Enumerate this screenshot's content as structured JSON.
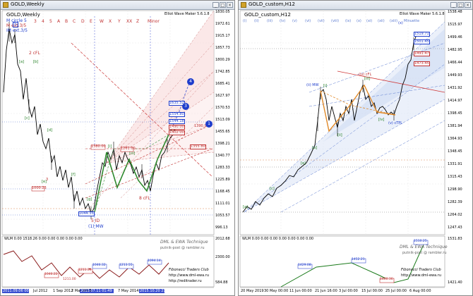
{
  "left": {
    "title": "GOLD,Weekly",
    "indicator": "Elliot Wave Maker 5.6.1.8",
    "stack": [
      "M circle 5",
      "M ext.3/5",
      "IM ext.3/5"
    ],
    "waves_top": [
      "3",
      "4",
      "5",
      "A",
      "B",
      "C",
      "D",
      "E",
      "W",
      "X",
      "Y",
      "XX",
      "Z",
      "Minor"
    ],
    "price_scale": [
      "1830.05",
      "1972.61",
      "1915.17",
      "1857.73",
      "1800.29",
      "1742.85",
      "1685.41",
      "1627.97",
      "1570.53",
      "1513.09",
      "1455.65",
      "1398.21",
      "1340.77",
      "1283.33",
      "1225.89",
      "1168.45",
      "1111.01",
      "1053.57",
      "996.13"
    ],
    "wave_labels": {
      "top5": "5",
      "cFL": "2 cFL",
      "w3": "3",
      "w5": "5 ID",
      "mw": "(1) MW",
      "cfl8": "8 cFL",
      "pr_a": "1000.23",
      "pr_b": "1044.35",
      "pr_c": "1380.00",
      "pr_d": "1261.00"
    },
    "price_boxes": [
      "1635.52",
      "1554.80",
      "1544.18",
      "1490.00",
      "1402.00",
      "1390.93",
      "1355.80"
    ],
    "circles": [
      "4",
      "3",
      "1"
    ],
    "sub_title": "WLM 0.00 1518.26 0.00 0.00 0.00 0.00 0.00",
    "sub_scale": [
      "2012.68",
      "2300.00",
      "584.88"
    ],
    "sub_values": [
      "1046.32",
      "1213.55",
      "1046.22",
      "1211.34",
      "1094.14",
      "1211.00"
    ],
    "watermark": [
      "DML & EWA Technique",
      "putnik-post @ rambler.ru"
    ],
    "signature": [
      "Fibonacci Traders Club",
      "http://www.dml-ewa.ru",
      "http://reditrader.ru"
    ],
    "dates": [
      "2011.09.06 00:00",
      "Jul 2012",
      "1 Sep 2012",
      "2 Mar 2013",
      "2013.07.11 01:49",
      "7 May 2014",
      "2015.10.20 21:00"
    ]
  },
  "right": {
    "title": "GOLD_custom,H12",
    "indicator": "Elliot Wave Maker 5.6.1.8",
    "waves_top": [
      "(i)",
      "(ii)",
      "(iii)",
      "(iv)",
      "(v)",
      "(vi)",
      "(vii)",
      "(viii)",
      "(ix)",
      "(x)",
      "(xi)",
      "(xii)",
      "(xiii)",
      "Minuette"
    ],
    "price_scale": [
      "1538.48",
      "1515.97",
      "1499.46",
      "1482.95",
      "1466.44",
      "1449.93",
      "1431.92",
      "1414.97",
      "1398.45",
      "1381.94",
      "1364.93",
      "1348.45",
      "1331.91",
      "1315.43",
      "1298.90",
      "1282.39",
      "1264.02",
      "1247.43"
    ],
    "wave_labels": {
      "mw": "(ii) MW",
      "cfl": "(iv) cFL",
      "tpl": "(v) cTPL",
      "x": "(x)"
    },
    "price_boxes": [
      "1519.71",
      "1501.45",
      "1491.47",
      "1473.45"
    ],
    "sub_title": "WLM 0.00 0.00 0.00 0.00 0.00 0.00 0.00",
    "sub_scale": [
      "1531.83",
      "1421.40"
    ],
    "sub_values": [
      "1429.08",
      "1452.21",
      "1400.36",
      "1510.25"
    ],
    "watermark": [
      "DML & EWA Technique",
      "putnik-post @ rambler.ru"
    ],
    "signature": [
      "Fibonacci Traders Club",
      "http://www.dml-ewa.ru"
    ],
    "dates": [
      "20 May 2019",
      "30 May 00:00",
      "11 Jun 00:00",
      "21 Jun 16:00",
      "3 Jul 00:00",
      "15 Jul 00:00",
      "25 Jul 00:00",
      "6 Aug 00:00"
    ]
  }
}
